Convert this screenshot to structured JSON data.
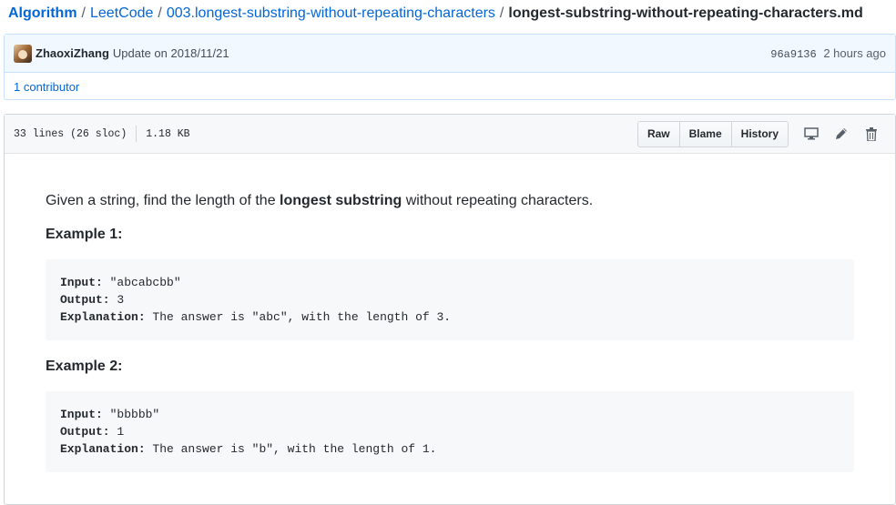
{
  "breadcrumb": {
    "repo": "Algorithm",
    "sep": "/",
    "path1": "LeetCode",
    "path2": "003.longest-substring-without-repeating-characters",
    "file": "longest-substring-without-repeating-characters.md"
  },
  "commit": {
    "author": "ZhaoxiZhang",
    "message": "Update on 2018/11/21",
    "sha": "96a9136",
    "time": "2 hours ago",
    "contributors": "1 contributor"
  },
  "file": {
    "lines": "33 lines (26 sloc)",
    "size": "1.18 KB",
    "buttons": {
      "raw": "Raw",
      "blame": "Blame",
      "history": "History"
    }
  },
  "content": {
    "intro_pre": "Given a string, find the length of the ",
    "intro_bold": "longest substring",
    "intro_post": " without repeating characters.",
    "example1_title": "Example 1:",
    "example1": {
      "input_label": "Input:",
      "input_value": " \"abcabcbb\"",
      "output_label": "Output:",
      "output_value": " 3",
      "explanation_label": "Explanation:",
      "explanation_value": " The answer is \"abc\", with the length of 3."
    },
    "example2_title": "Example 2:",
    "example2": {
      "input_label": "Input:",
      "input_value": " \"bbbbb\"",
      "output_label": "Output:",
      "output_value": " 1",
      "explanation_label": "Explanation:",
      "explanation_value": " The answer is \"b\", with the length of 1."
    }
  },
  "colors": {
    "link": "#0366d6",
    "commit_bg": "#f1f8ff",
    "code_bg": "#f6f8fa"
  }
}
